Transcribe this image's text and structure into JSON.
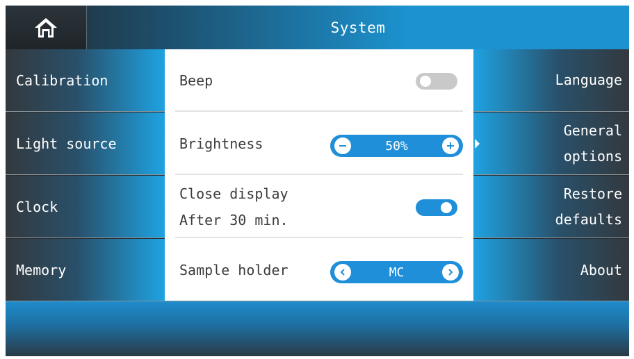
{
  "header": {
    "title": "System",
    "home_icon": "home-icon"
  },
  "left_nav": {
    "items": [
      {
        "label": "Calibration"
      },
      {
        "label": "Light source"
      },
      {
        "label": "Clock"
      },
      {
        "label": "Memory"
      }
    ]
  },
  "right_nav": {
    "items": [
      {
        "line1": "Language",
        "line2": ""
      },
      {
        "line1": "General",
        "line2": "options",
        "active": true
      },
      {
        "line1": "Restore",
        "line2": "defaults"
      },
      {
        "line1": "About",
        "line2": ""
      }
    ]
  },
  "settings": {
    "beep": {
      "label": "Beep",
      "enabled": false
    },
    "brightness": {
      "label": "Brightness",
      "value": "50%",
      "minus_icon": "minus-icon",
      "plus_icon": "plus-icon"
    },
    "close_display": {
      "label": "Close display",
      "sublabel": "After 30 min.",
      "enabled": true
    },
    "sample_holder": {
      "label": "Sample holder",
      "value": "MC",
      "prev_icon": "chevron-left-icon",
      "next_icon": "chevron-right-icon"
    }
  },
  "colors": {
    "accent": "#1e8fd8",
    "dark": "#2a2d30",
    "toggle_off": "#c9c9c9",
    "text": "#3c3c3c"
  }
}
